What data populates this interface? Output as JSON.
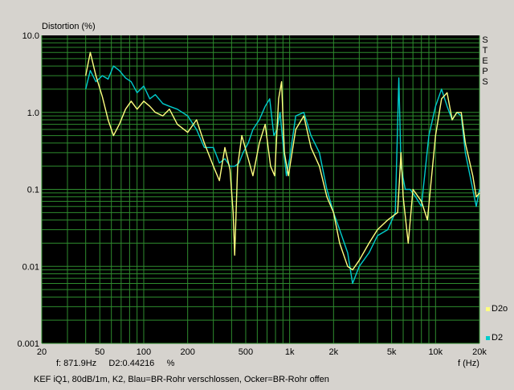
{
  "chart_data": {
    "type": "line",
    "title": "Distortion (%)",
    "xlabel": "f (Hz)",
    "ylabel": "Distortion (%)",
    "xscale": "log",
    "yscale": "log",
    "xlim": [
      20,
      20000
    ],
    "ylim": [
      0.001,
      10
    ],
    "grid": true,
    "x_ticks": [
      "20",
      "50",
      "100",
      "200",
      "500",
      "1k",
      "2k",
      "5k",
      "10k",
      "20k"
    ],
    "y_ticks": [
      "10.0",
      "1.0",
      "0.1",
      "0.01",
      "0.001"
    ],
    "side_label": "STEPS",
    "legend": [
      "D2o",
      "D2"
    ],
    "series": [
      {
        "name": "D2o",
        "color": "#ffff80",
        "points": [
          [
            40,
            3
          ],
          [
            43,
            6
          ],
          [
            47,
            3
          ],
          [
            52,
            1.6
          ],
          [
            57,
            0.8
          ],
          [
            62,
            0.5
          ],
          [
            68,
            0.7
          ],
          [
            75,
            1.1
          ],
          [
            82,
            1.4
          ],
          [
            90,
            1.1
          ],
          [
            100,
            1.4
          ],
          [
            110,
            1.2
          ],
          [
            120,
            1.0
          ],
          [
            135,
            0.9
          ],
          [
            150,
            1.1
          ],
          [
            170,
            0.7
          ],
          [
            200,
            0.55
          ],
          [
            230,
            0.8
          ],
          [
            260,
            0.4
          ],
          [
            300,
            0.2
          ],
          [
            330,
            0.13
          ],
          [
            360,
            0.35
          ],
          [
            390,
            0.18
          ],
          [
            410,
            0.05
          ],
          [
            420,
            0.014
          ],
          [
            440,
            0.2
          ],
          [
            470,
            0.5
          ],
          [
            520,
            0.25
          ],
          [
            560,
            0.15
          ],
          [
            620,
            0.4
          ],
          [
            680,
            0.7
          ],
          [
            740,
            0.2
          ],
          [
            790,
            0.15
          ],
          [
            840,
            1.5
          ],
          [
            880,
            2.5
          ],
          [
            920,
            0.3
          ],
          [
            980,
            0.15
          ],
          [
            1100,
            0.6
          ],
          [
            1250,
            0.9
          ],
          [
            1400,
            0.35
          ],
          [
            1600,
            0.2
          ],
          [
            1800,
            0.08
          ],
          [
            2000,
            0.05
          ],
          [
            2200,
            0.02
          ],
          [
            2500,
            0.01
          ],
          [
            2700,
            0.009
          ],
          [
            3000,
            0.012
          ],
          [
            3500,
            0.02
          ],
          [
            4000,
            0.03
          ],
          [
            4700,
            0.04
          ],
          [
            5500,
            0.05
          ],
          [
            5800,
            0.3
          ],
          [
            6000,
            0.08
          ],
          [
            6500,
            0.02
          ],
          [
            7000,
            0.1
          ],
          [
            8000,
            0.07
          ],
          [
            8800,
            0.04
          ],
          [
            10000,
            0.5
          ],
          [
            11000,
            1.5
          ],
          [
            12000,
            1.8
          ],
          [
            13000,
            0.8
          ],
          [
            14000,
            1.0
          ],
          [
            15000,
            1.0
          ],
          [
            16000,
            0.4
          ],
          [
            18000,
            0.15
          ],
          [
            19000,
            0.08
          ],
          [
            20000,
            0.09
          ]
        ]
      },
      {
        "name": "D2",
        "color": "#00cccc",
        "points": [
          [
            40,
            2
          ],
          [
            43,
            3.5
          ],
          [
            47,
            2.5
          ],
          [
            52,
            3
          ],
          [
            57,
            2.7
          ],
          [
            62,
            4
          ],
          [
            68,
            3.5
          ],
          [
            75,
            2.8
          ],
          [
            82,
            2.5
          ],
          [
            90,
            1.8
          ],
          [
            100,
            2.2
          ],
          [
            110,
            1.5
          ],
          [
            120,
            1.7
          ],
          [
            135,
            1.3
          ],
          [
            150,
            1.2
          ],
          [
            170,
            1.1
          ],
          [
            200,
            0.9
          ],
          [
            230,
            0.6
          ],
          [
            260,
            0.35
          ],
          [
            300,
            0.35
          ],
          [
            330,
            0.22
          ],
          [
            360,
            0.25
          ],
          [
            390,
            0.2
          ],
          [
            420,
            0.2
          ],
          [
            450,
            0.22
          ],
          [
            480,
            0.3
          ],
          [
            520,
            0.4
          ],
          [
            560,
            0.6
          ],
          [
            620,
            0.8
          ],
          [
            680,
            1.2
          ],
          [
            730,
            1.5
          ],
          [
            780,
            0.5
          ],
          [
            820,
            0.6
          ],
          [
            860,
            1.0
          ],
          [
            900,
            0.4
          ],
          [
            950,
            0.15
          ],
          [
            1000,
            0.25
          ],
          [
            1100,
            0.9
          ],
          [
            1250,
            1.0
          ],
          [
            1400,
            0.5
          ],
          [
            1600,
            0.3
          ],
          [
            1800,
            0.1
          ],
          [
            2000,
            0.05
          ],
          [
            2200,
            0.03
          ],
          [
            2500,
            0.015
          ],
          [
            2700,
            0.006
          ],
          [
            3000,
            0.01
          ],
          [
            3500,
            0.015
          ],
          [
            4000,
            0.025
          ],
          [
            4700,
            0.03
          ],
          [
            5300,
            0.05
          ],
          [
            5600,
            2.8
          ],
          [
            5800,
            0.2
          ],
          [
            6200,
            0.1
          ],
          [
            6700,
            0.1
          ],
          [
            7300,
            0.08
          ],
          [
            8000,
            0.06
          ],
          [
            9000,
            0.5
          ],
          [
            10000,
            1.2
          ],
          [
            11000,
            2.0
          ],
          [
            12000,
            1.2
          ],
          [
            13000,
            0.8
          ],
          [
            14000,
            1.0
          ],
          [
            15000,
            0.9
          ],
          [
            16000,
            0.3
          ],
          [
            18000,
            0.1
          ],
          [
            19000,
            0.06
          ],
          [
            20000,
            0.1
          ]
        ]
      }
    ]
  },
  "readout": {
    "freq": "f: 871.9Hz",
    "value": "D2:0.44216",
    "unit": "%"
  },
  "caption": "KEF iQ1, 80dB/1m, K2, Blau=BR-Rohr verschlossen, Ocker=BR-Rohr offen"
}
